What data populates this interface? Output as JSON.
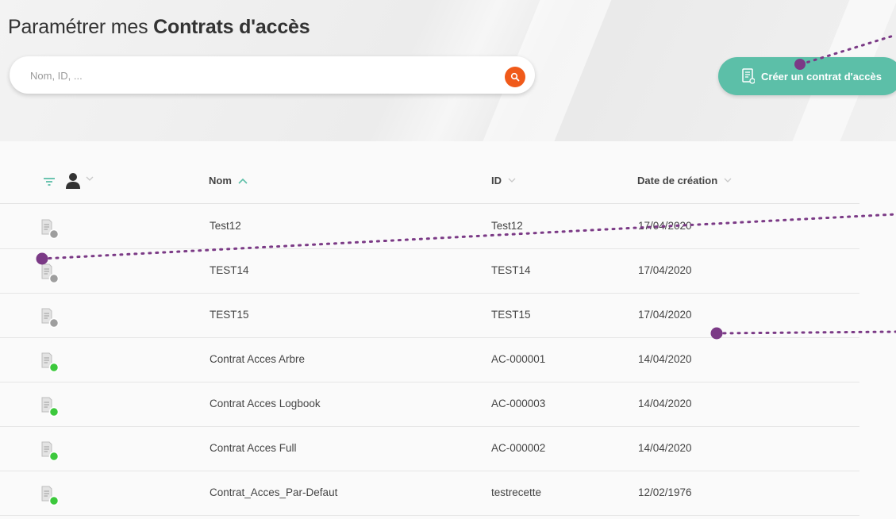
{
  "header": {
    "title_prefix": "Paramétrer mes",
    "title_bold": "Contrats d'accès"
  },
  "search": {
    "placeholder": "Nom, ID, ...",
    "value": "",
    "button_icon": "search-icon"
  },
  "create_button": {
    "label": "Créer un contrat d'accès",
    "icon": "document-add-icon"
  },
  "table": {
    "filter_icon": "filter-icon",
    "user_icon": "user-icon",
    "columns": [
      {
        "label": "Nom",
        "sort": "asc"
      },
      {
        "label": "ID",
        "sort": "none"
      },
      {
        "label": "Date de création",
        "sort": "none"
      }
    ],
    "rows": [
      {
        "name": "Test12",
        "id": "Test12",
        "date": "17/04/2020",
        "status": "inactive"
      },
      {
        "name": "TEST14",
        "id": "TEST14",
        "date": "17/04/2020",
        "status": "inactive"
      },
      {
        "name": "TEST15",
        "id": "TEST15",
        "date": "17/04/2020",
        "status": "inactive"
      },
      {
        "name": "Contrat Acces Arbre",
        "id": "AC-000001",
        "date": "14/04/2020",
        "status": "active"
      },
      {
        "name": "Contrat Acces Logbook",
        "id": "AC-000003",
        "date": "14/04/2020",
        "status": "active"
      },
      {
        "name": "Contrat Acces Full",
        "id": "AC-000002",
        "date": "14/04/2020",
        "status": "active"
      },
      {
        "name": "Contrat_Acces_Par-Defaut",
        "id": "testrecette",
        "date": "12/02/1976",
        "status": "active"
      }
    ]
  },
  "colors": {
    "accent_teal": "#5cbfa8",
    "search_orange": "#f05a1a",
    "status_inactive": "#9e9e9e",
    "status_active": "#3cc83c",
    "annotation": "#7b3a86"
  }
}
